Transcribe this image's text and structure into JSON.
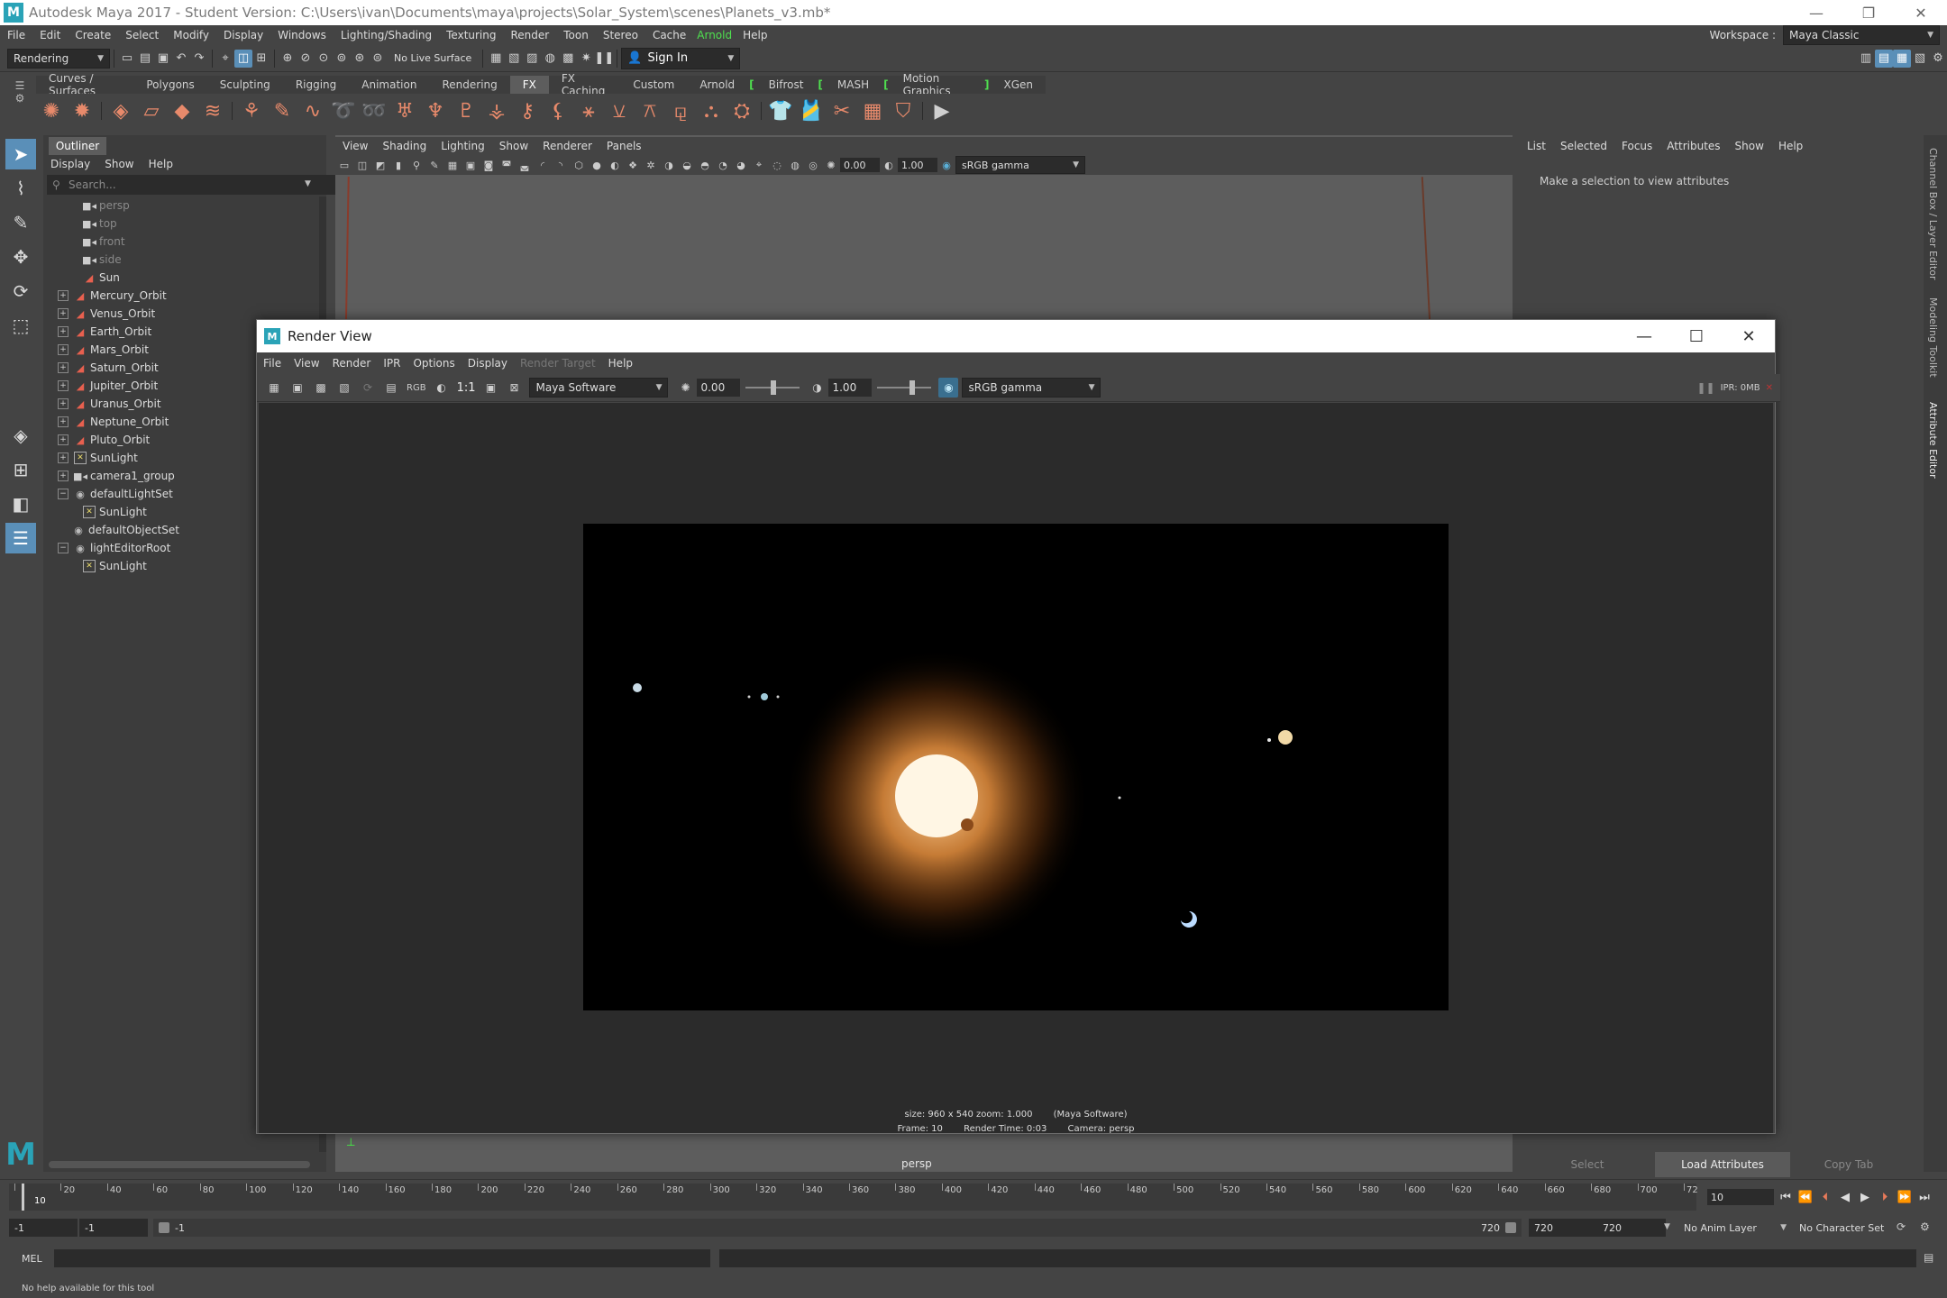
{
  "window": {
    "title": "Autodesk Maya 2017 - Student Version: C:\\Users\\ivan\\Documents\\maya\\projects\\Solar_System\\scenes\\Planets_v3.mb*",
    "logo_letter": "M",
    "minimize": "—",
    "restore": "❐",
    "close": "✕"
  },
  "menubar": {
    "items": [
      "File",
      "Edit",
      "Create",
      "Select",
      "Modify",
      "Display",
      "Windows",
      "Lighting/Shading",
      "Texturing",
      "Render",
      "Toon",
      "Stereo",
      "Cache"
    ],
    "arnold": "Arnold",
    "help": "Help",
    "workspace_label": "Workspace :",
    "workspace_value": "Maya Classic"
  },
  "statusline": {
    "menuset": "Rendering",
    "live_surface": "No Live Surface",
    "sign_in": "Sign In"
  },
  "shelf": {
    "tabs": [
      "Curves / Surfaces",
      "Polygons",
      "Sculpting",
      "Rigging",
      "Animation",
      "Rendering",
      "FX",
      "FX Caching",
      "Custom",
      "Arnold",
      "Bifrost",
      "MASH",
      "Motion Graphics",
      "XGen"
    ],
    "active_tab": "FX"
  },
  "outliner": {
    "tab": "Outliner",
    "menu": [
      "Display",
      "Show",
      "Help"
    ],
    "search_placeholder": "Search...",
    "items": [
      {
        "label": "persp",
        "icon": "camera",
        "indent": 1,
        "dim": true,
        "expand": ""
      },
      {
        "label": "top",
        "icon": "camera",
        "indent": 1,
        "dim": true,
        "expand": ""
      },
      {
        "label": "front",
        "icon": "camera",
        "indent": 1,
        "dim": true,
        "expand": ""
      },
      {
        "label": "side",
        "icon": "camera",
        "indent": 1,
        "dim": true,
        "expand": ""
      },
      {
        "label": "Sun",
        "icon": "transform",
        "indent": 1,
        "dim": false,
        "expand": ""
      },
      {
        "label": "Mercury_Orbit",
        "icon": "transform",
        "indent": 0,
        "dim": false,
        "expand": "+"
      },
      {
        "label": "Venus_Orbit",
        "icon": "transform",
        "indent": 0,
        "dim": false,
        "expand": "+"
      },
      {
        "label": "Earth_Orbit",
        "icon": "transform",
        "indent": 0,
        "dim": false,
        "expand": "+"
      },
      {
        "label": "Mars_Orbit",
        "icon": "transform",
        "indent": 0,
        "dim": false,
        "expand": "+"
      },
      {
        "label": "Saturn_Orbit",
        "icon": "transform",
        "indent": 0,
        "dim": false,
        "expand": "+"
      },
      {
        "label": "Jupiter_Orbit",
        "icon": "transform",
        "indent": 0,
        "dim": false,
        "expand": "+"
      },
      {
        "label": "Uranus_Orbit",
        "icon": "transform",
        "indent": 0,
        "dim": false,
        "expand": "+"
      },
      {
        "label": "Neptune_Orbit",
        "icon": "transform",
        "indent": 0,
        "dim": false,
        "expand": "+"
      },
      {
        "label": "Pluto_Orbit",
        "icon": "transform",
        "indent": 0,
        "dim": false,
        "expand": "+"
      },
      {
        "label": "SunLight",
        "icon": "light",
        "indent": 0,
        "dim": false,
        "expand": "+"
      },
      {
        "label": "camera1_group",
        "icon": "camera",
        "indent": 0,
        "dim": false,
        "expand": "+"
      },
      {
        "label": "defaultLightSet",
        "icon": "set",
        "indent": 0,
        "dim": false,
        "expand": "−"
      },
      {
        "label": "SunLight",
        "icon": "light",
        "indent": 1,
        "dim": false,
        "expand": ""
      },
      {
        "label": "defaultObjectSet",
        "icon": "set",
        "indent": 0,
        "dim": false,
        "expand": ""
      },
      {
        "label": "lightEditorRoot",
        "icon": "set",
        "indent": 0,
        "dim": false,
        "expand": "−"
      },
      {
        "label": "SunLight",
        "icon": "light",
        "indent": 1,
        "dim": false,
        "expand": ""
      }
    ]
  },
  "viewport": {
    "menu": [
      "View",
      "Shading",
      "Lighting",
      "Show",
      "Renderer",
      "Panels"
    ],
    "exposure": "0.00",
    "gamma": "1.00",
    "colorspace": "sRGB gamma",
    "camera_label": "persp"
  },
  "channelbox": {
    "menu": [
      "List",
      "Selected",
      "Focus",
      "Attributes",
      "Show",
      "Help"
    ],
    "hint": "Make a selection to view attributes",
    "select_button": "Select",
    "load_button": "Load Attributes",
    "copy_button": "Copy Tab",
    "side_tabs": [
      "Channel Box / Layer Editor",
      "Modeling Toolkit",
      "Attribute Editor"
    ]
  },
  "renderview": {
    "title": "Render View",
    "menu": [
      "File",
      "View",
      "Render",
      "IPR",
      "Options",
      "Display"
    ],
    "menu_disabled": "Render Target",
    "menu_help": "Help",
    "rgb": "RGB",
    "ratio": "1:1",
    "renderer": "Maya Software",
    "exposure": "0.00",
    "gamma": "1.00",
    "colorspace": "sRGB gamma",
    "ipr": "IPR: 0MB",
    "info_size": "size: 960 x 540  zoom: 1.000",
    "info_renderer": "(Maya Software)",
    "info_frame": "Frame: 10",
    "info_time": "Render Time: 0:03",
    "info_camera": "Camera: persp"
  },
  "timeline": {
    "labels": [
      "10",
      "20",
      "40",
      "60",
      "80",
      "100",
      "120",
      "140",
      "160",
      "180",
      "200",
      "220",
      "240",
      "260",
      "280",
      "300",
      "320",
      "340",
      "360",
      "380",
      "400",
      "420",
      "440",
      "460",
      "480",
      "500",
      "520",
      "540",
      "560",
      "580",
      "600",
      "620",
      "640",
      "660",
      "680",
      "700",
      "72"
    ],
    "current_frame": "10"
  },
  "range": {
    "start": "-1",
    "anim_start": "-1",
    "slider_start": "-1",
    "slider_end": "720",
    "anim_end": "720",
    "end": "720",
    "anim_layer": "No Anim Layer",
    "character_set": "No Character Set"
  },
  "cmdline": {
    "label": "MEL"
  },
  "helpline": {
    "text": "No help available for this tool"
  },
  "colors": {
    "accent": "#5a8fb8",
    "shelf_icon": "#e88a6b",
    "arnold_green": "#4fe04f"
  }
}
